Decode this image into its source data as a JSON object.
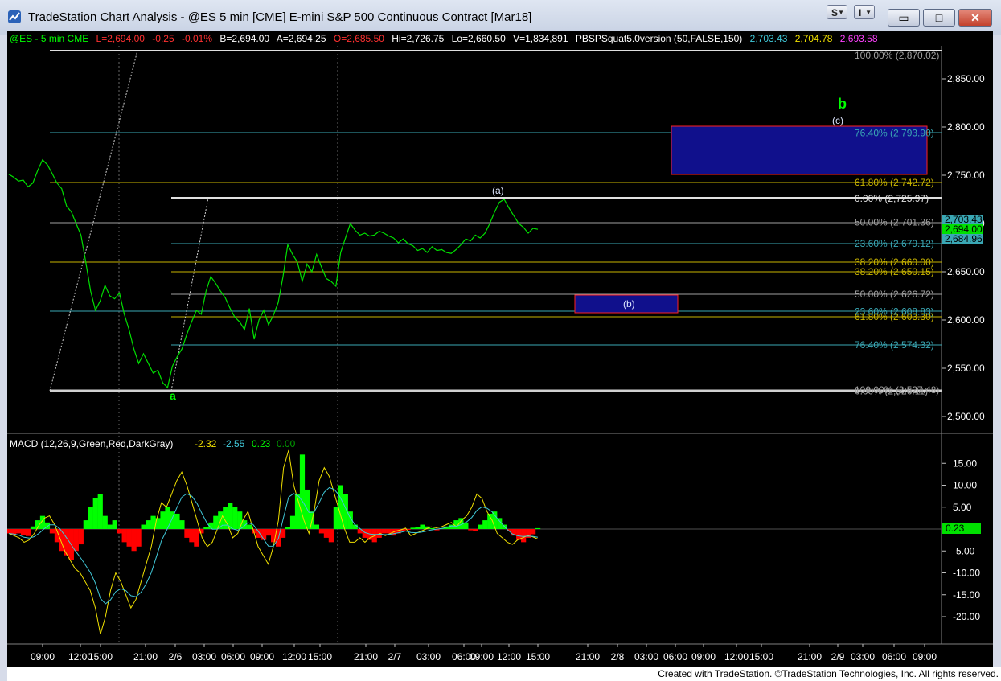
{
  "window": {
    "title": "TradeStation Chart Analysis - @ES 5 min [CME] E-mini S&P 500 Continuous Contract [Mar18]",
    "btn_s": "S",
    "btn_i": "I",
    "minimize_glyph": "▭",
    "maximize_glyph": "□",
    "close_glyph": "✕"
  },
  "infobar": {
    "symbol": "@ES - 5 min  CME",
    "last": "L=2,694.00",
    "change": "-0.25",
    "pct": "-0.01%",
    "bid": "B=2,694.00",
    "ask": "A=2,694.25",
    "open": "O=2,685.50",
    "hi": "Hi=2,726.75",
    "lo": "Lo=2,660.50",
    "vol": "V=1,834,891",
    "indicator": "PBSPSquat5.0version (50,FALSE,150)",
    "ind_v1": "2,703.43",
    "ind_v2": "2,704.78",
    "ind_v3": "2,693.58"
  },
  "colors": {
    "price": "#00e000",
    "up": "#00ff00",
    "down": "#ff0000",
    "text_green": "#00ff00",
    "text_red": "#ff3030",
    "fib_gray": "#a0a0a0",
    "fib_yellow": "#c8b400",
    "fib_cyan": "#3aa7b4",
    "box_fill": "#10108c",
    "box_border": "#ff2020"
  },
  "price_axis": [
    "2,850.00",
    "2,800.00",
    "2,750.00",
    "2,700.00",
    "2,650.00",
    "2,600.00",
    "2,550.00",
    "2,500.00"
  ],
  "price_tags": {
    "ind": "2,703.43",
    "last": "2,694.00",
    "low": "2,684.96"
  },
  "time_axis": [
    "09:00",
    "12:00",
    "15:00",
    "21:00",
    "2/6",
    "03:00",
    "06:00",
    "09:00",
    "12:00",
    "15:00",
    "21:00",
    "2/7",
    "03:00",
    "06:00",
    "09:00",
    "12:00",
    "15:00",
    "21:00",
    "2/8",
    "03:00",
    "06:00",
    "09:00",
    "12:00",
    "15:00",
    "21:00",
    "2/9",
    "03:00",
    "06:00",
    "09:00"
  ],
  "fib_labels": [
    {
      "text": "100.00% (2,870.02)",
      "price": 2874,
      "color": "#a0a0a0"
    },
    {
      "text": "76.40% (2,793.90)",
      "price": 2793.9,
      "color": "#3aa7b4"
    },
    {
      "text": "61.80% (2,742.72)",
      "price": 2742.7,
      "color": "#c8b400"
    },
    {
      "text": "0.00% (2,725.97)",
      "price": 2726,
      "color": "#e0e0e0"
    },
    {
      "text": "50.00% (2,701.36)",
      "price": 2701.4,
      "color": "#a0a0a0"
    },
    {
      "text": "23.60% (2,679.12)",
      "price": 2679.1,
      "color": "#3aa7b4"
    },
    {
      "text": "38.20% (2,660.00)",
      "price": 2660,
      "color": "#c8b400"
    },
    {
      "text": "38.20% (2,650.15)",
      "price": 2650.2,
      "color": "#c8b400"
    },
    {
      "text": "50.00% (2,626.72)",
      "price": 2626.7,
      "color": "#a0a0a0"
    },
    {
      "text": "23.60% (2,608.83)",
      "price": 2608.8,
      "color": "#3aa7b4"
    },
    {
      "text": "61.80% (2,603.30)",
      "price": 2603.3,
      "color": "#c8b400"
    },
    {
      "text": "76.40% (2,574.32)",
      "price": 2574.3,
      "color": "#3aa7b4"
    },
    {
      "text": "100.00% (2,527.48)",
      "price": 2527.5,
      "color": "#a0a0a0"
    },
    {
      "text": "0.00% (2,526.11)",
      "price": 2526.1,
      "color": "#a0a0a0"
    }
  ],
  "wave_labels": {
    "a": "a",
    "b": "b",
    "c": "(c)",
    "wa": "(a)",
    "wb": "(b)"
  },
  "macd": {
    "title": "MACD (12,26,9,Green,Red,DarkGray)",
    "v1": "-2.32",
    "v2": "-2.55",
    "v3": "0.23",
    "v4": "0.00",
    "tag": "0.23",
    "axis": [
      "15.00",
      "10.00",
      "5.00",
      "-5.00",
      "-10.00",
      "-15.00",
      "-20.00"
    ]
  },
  "price_series": [
    2751,
    2748,
    2744,
    2745,
    2738,
    2742,
    2755,
    2766,
    2761,
    2752,
    2742,
    2736,
    2718,
    2712,
    2700,
    2688,
    2660,
    2630,
    2610,
    2620,
    2636,
    2625,
    2622,
    2628,
    2606,
    2590,
    2570,
    2555,
    2565,
    2555,
    2545,
    2548,
    2535,
    2530,
    2552,
    2562,
    2570,
    2585,
    2598,
    2610,
    2606,
    2630,
    2645,
    2638,
    2630,
    2623,
    2612,
    2603,
    2598,
    2590,
    2612,
    2580,
    2600,
    2610,
    2595,
    2605,
    2618,
    2645,
    2678,
    2668,
    2660,
    2640,
    2658,
    2650,
    2668,
    2655,
    2643,
    2640,
    2635,
    2670,
    2685,
    2700,
    2693,
    2688,
    2690,
    2687,
    2688,
    2692,
    2690,
    2687,
    2685,
    2680,
    2684,
    2679,
    2677,
    2672,
    2674,
    2670,
    2676,
    2672,
    2673,
    2670,
    2669,
    2673,
    2678,
    2684,
    2682,
    2688,
    2685,
    2690,
    2700,
    2712,
    2722,
    2725,
    2716,
    2708,
    2700,
    2696,
    2690,
    2695,
    2694
  ],
  "macd_hist": [
    -1,
    -1.3,
    -1,
    -1.4,
    -1.6,
    0.6,
    2,
    3,
    1.5,
    -1,
    -3,
    -5,
    -6,
    -7,
    -5,
    -3.5,
    2,
    5,
    7,
    8,
    3,
    1,
    2,
    -1,
    -3,
    -4,
    -5,
    -4,
    1,
    2,
    3,
    2.5,
    4,
    5,
    4,
    3.5,
    2,
    -2,
    -3,
    -4,
    -1,
    0.5,
    1.5,
    3,
    4,
    5,
    6,
    5,
    4,
    2,
    1,
    -1,
    -2,
    -2.5,
    -1.5,
    -3,
    -4,
    -2,
    0.5,
    3,
    8,
    17,
    9,
    4,
    1,
    -1,
    -2,
    -3,
    5,
    10,
    8,
    4,
    1,
    -1,
    -2,
    -2.5,
    -3,
    -2,
    -1,
    -1,
    -1.5,
    -1,
    -0.5,
    -0.2,
    0.3,
    0.5,
    1,
    0.6,
    0.2,
    -0.3,
    0.2,
    0.6,
    1,
    2,
    2.5,
    1.5,
    -0.3,
    -0.5,
    1,
    2,
    3.5,
    4,
    2.5,
    1,
    -0.5,
    -1.5,
    -2.5,
    -3,
    -2,
    -1.2,
    0.2
  ],
  "macd_line": [
    -1,
    -1.5,
    -2,
    -3,
    -2.5,
    -1,
    1,
    2.5,
    3,
    1,
    -2,
    -5,
    -7,
    -9,
    -10,
    -12,
    -14,
    -18,
    -24,
    -20,
    -14,
    -10,
    -12,
    -15,
    -18,
    -16,
    -12,
    -8,
    -4,
    2,
    6,
    5,
    8,
    11,
    13,
    10,
    6,
    2,
    -2,
    -4,
    -3,
    0,
    3,
    1,
    -2,
    -1,
    2,
    4,
    0,
    -4,
    -6,
    -8,
    -4,
    2,
    14,
    18,
    10,
    6,
    2,
    -1,
    4,
    11,
    14,
    12,
    8,
    4,
    0,
    -3,
    -3,
    -2,
    -3,
    -2,
    -1.5,
    -1,
    -1.5,
    -1,
    -0.5,
    -0.2,
    0.2,
    -1.5,
    -1,
    -0.5,
    0,
    0.5,
    0.3,
    0.5,
    1,
    1.5,
    0.5,
    2,
    3,
    5,
    8,
    7,
    4,
    2,
    -1,
    -2,
    -3,
    -3.5,
    -2.5,
    -2,
    -1.5,
    -1.8,
    -2.3
  ]
}
